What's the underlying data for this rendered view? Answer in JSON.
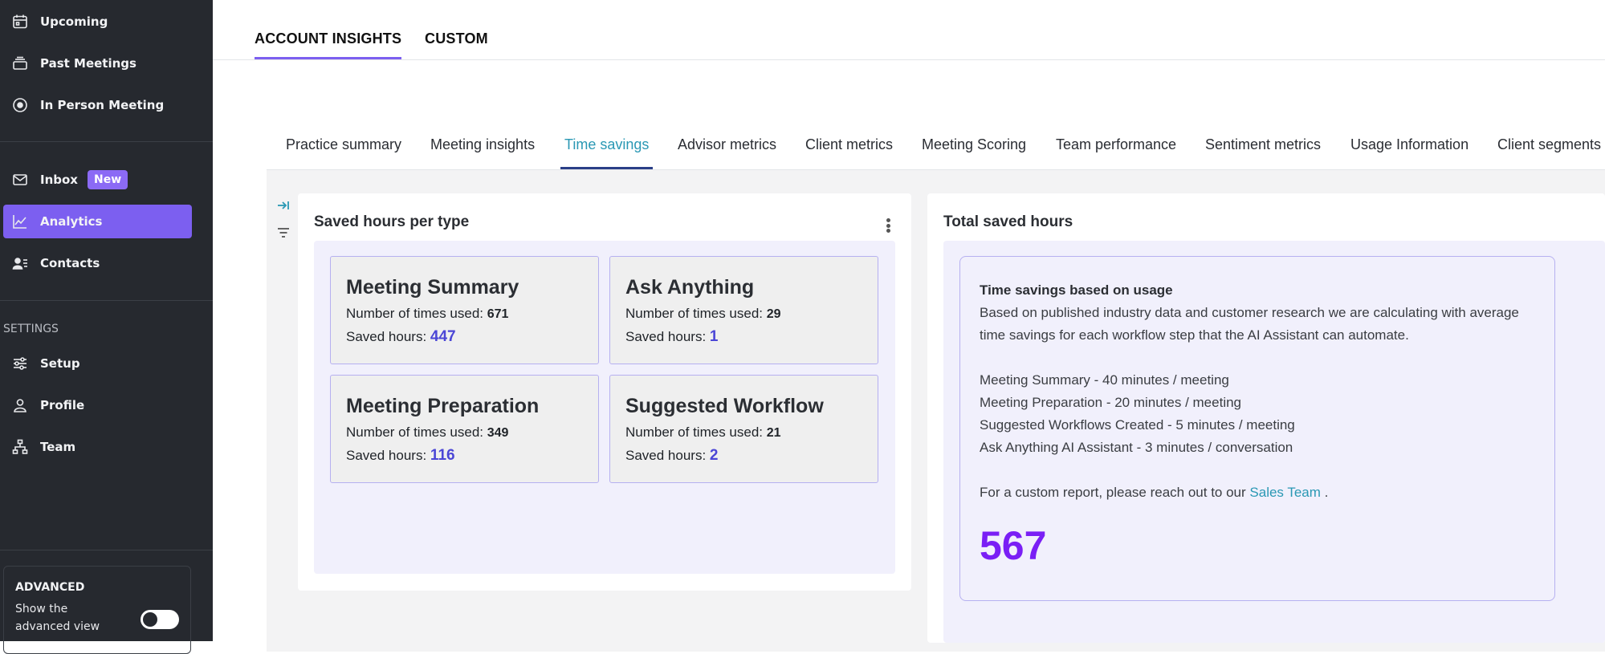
{
  "sidebar": {
    "items": [
      {
        "label": "Upcoming",
        "icon": "calendar-icon"
      },
      {
        "label": "Past Meetings",
        "icon": "stack-icon"
      },
      {
        "label": "In Person Meeting",
        "icon": "record-icon"
      },
      {
        "label": "Inbox",
        "icon": "mail-icon",
        "badge": "New"
      },
      {
        "label": "Analytics",
        "icon": "chart-line-icon",
        "active": true
      },
      {
        "label": "Contacts",
        "icon": "contacts-icon"
      }
    ],
    "settings_label": "SETTINGS",
    "settings_items": [
      {
        "label": "Setup",
        "icon": "sliders-icon"
      },
      {
        "label": "Profile",
        "icon": "user-icon"
      },
      {
        "label": "Team",
        "icon": "org-chart-icon"
      }
    ],
    "advanced": {
      "title": "ADVANCED",
      "description": "Show the advanced view",
      "toggle_on": false
    }
  },
  "top_tabs": [
    {
      "label": "ACCOUNT INSIGHTS",
      "active": true
    },
    {
      "label": "CUSTOM",
      "active": false
    }
  ],
  "sub_tabs": [
    {
      "label": "Practice summary"
    },
    {
      "label": "Meeting insights"
    },
    {
      "label": "Time savings",
      "active": true
    },
    {
      "label": "Advisor metrics"
    },
    {
      "label": "Client metrics"
    },
    {
      "label": "Meeting Scoring"
    },
    {
      "label": "Team performance"
    },
    {
      "label": "Sentiment metrics"
    },
    {
      "label": "Usage Information"
    },
    {
      "label": "Client segments"
    }
  ],
  "saved_hours_panel": {
    "title": "Saved hours per type",
    "used_label": "Number of times used:",
    "hours_label": "Saved hours:",
    "cards": [
      {
        "title": "Meeting Summary",
        "times_used": "671",
        "saved_hours": "447"
      },
      {
        "title": "Ask Anything",
        "times_used": "29",
        "saved_hours": "1"
      },
      {
        "title": "Meeting Preparation",
        "times_used": "349",
        "saved_hours": "116"
      },
      {
        "title": "Suggested Workflow",
        "times_used": "21",
        "saved_hours": "2"
      }
    ]
  },
  "total_panel": {
    "title": "Total saved hours",
    "heading": "Time savings based on usage",
    "description": "Based on published industry data and customer research we are calculating with average time savings for each workflow step that the AI Assistant can automate.",
    "rates": [
      "Meeting Summary - 40 minutes / meeting",
      "Meeting Preparation - 20 minutes / meeting",
      "Suggested Workflows Created - 5 minutes / meeting",
      "Ask Anything AI Assistant - 3 minutes / conversation"
    ],
    "contact_prefix": "For a custom report, please reach out to our",
    "contact_link": "Sales Team",
    "contact_suffix": ".",
    "total": "567"
  },
  "colors": {
    "sidebar_bg": "#26292f",
    "accent": "#7c5ff0",
    "active_subtab": "#2a98b4",
    "total_number": "#7a1ff5",
    "hours_value": "#4b46d6"
  }
}
